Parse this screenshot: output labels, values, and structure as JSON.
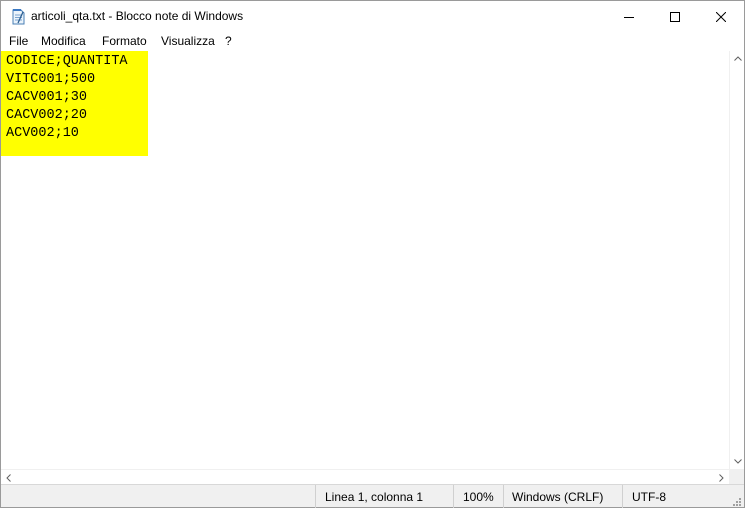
{
  "window": {
    "title": "articoli_qta.txt - Blocco note di Windows"
  },
  "menu": {
    "items": [
      "File",
      "Modifica",
      "Formato",
      "Visualizza",
      "?"
    ]
  },
  "editor": {
    "lines": [
      "CODICE;QUANTITA",
      "VITC001;500",
      "CACV001;30",
      "CACV002;20",
      "ACV002;10"
    ],
    "highlight_color": "#ffff00"
  },
  "status": {
    "position": "Linea 1, colonna 1",
    "zoom": "100%",
    "line_ending": "Windows (CRLF)",
    "encoding": "UTF-8"
  },
  "icons": {
    "app": "notepad-icon",
    "minimize": "minimize-icon",
    "maximize": "maximize-icon",
    "close": "close-icon"
  }
}
